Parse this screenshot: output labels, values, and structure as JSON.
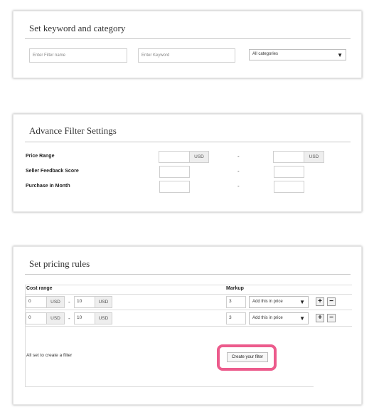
{
  "keyword_section": {
    "title": "Set keyword and category",
    "filter_name_placeholder": "Enter Filter name",
    "keyword_placeholder": "Enter Keyword",
    "category_selected": "All categories"
  },
  "advance_section": {
    "title": "Advance Filter Settings",
    "price_range_label": "Price Range",
    "seller_feedback_label": "Seller Feedback Score",
    "purchase_month_label": "Purchase in Month",
    "currency": "USD",
    "separator": "-"
  },
  "pricing_section": {
    "title": "Set pricing rules",
    "col_cost_range": "Cost range",
    "col_markup": "Markup",
    "rows": [
      {
        "from": "0",
        "to": "10",
        "currency": "USD",
        "markup": "3",
        "mode": "Add this in price"
      },
      {
        "from": "0",
        "to": "10",
        "currency": "USD",
        "markup": "3",
        "mode": "Add this in price"
      }
    ],
    "separator": "-",
    "plus": "+",
    "minus": "−",
    "ready_text": "All set to create a filter",
    "create_button": "Create your filter"
  }
}
